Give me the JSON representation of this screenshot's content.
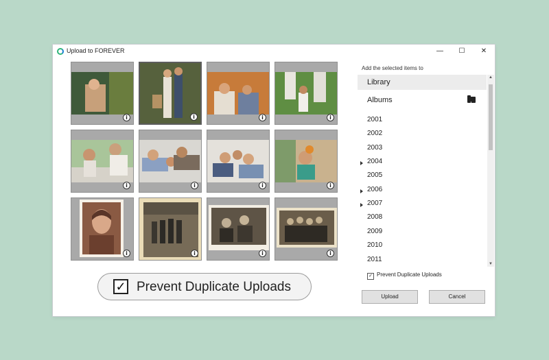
{
  "window": {
    "title": "Upload to FOREVER"
  },
  "controls": {
    "minimize": "—",
    "maximize": "☐",
    "close": "✕"
  },
  "tiles": [
    {
      "info": "i"
    },
    {
      "info": "i"
    },
    {
      "info": "i"
    },
    {
      "info": "i"
    },
    {
      "info": "i"
    },
    {
      "info": "i"
    },
    {
      "info": "i"
    },
    {
      "info": "i"
    },
    {
      "info": "i"
    },
    {
      "info": "i"
    },
    {
      "info": "i"
    },
    {
      "info": "i"
    }
  ],
  "sidebar": {
    "label": "Add the selected items to",
    "library": "Library",
    "albums": "Albums",
    "years": [
      "2001",
      "2002",
      "2003",
      "2004",
      "2005",
      "2006",
      "2007",
      "2008",
      "2009",
      "2010",
      "2011"
    ],
    "expandable": [
      "2004",
      "2006",
      "2007"
    ]
  },
  "options": {
    "prevent_duplicates_small": "Prevent Duplicate Uploads",
    "prevent_duplicates_large": "Prevent Duplicate Uploads",
    "checked": true
  },
  "buttons": {
    "upload": "Upload",
    "cancel": "Cancel"
  },
  "colors": {
    "background": "#b9d8c8",
    "tile_border": "#a9a9a9",
    "accent": "#2fb67a"
  }
}
